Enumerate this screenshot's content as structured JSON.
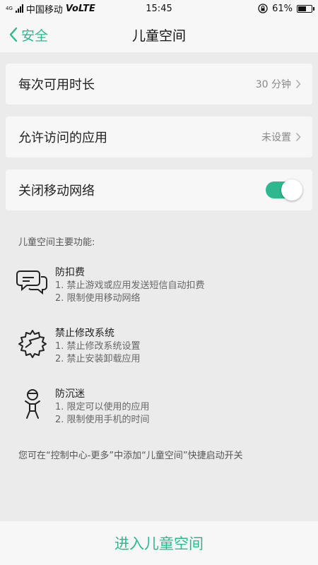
{
  "status_bar": {
    "network_type": "4G",
    "carrier": "中国移动",
    "volte": "VoLTE",
    "time": "15:45",
    "battery_percent": "61%",
    "battery_level": 0.61
  },
  "nav": {
    "back_label": "安全",
    "title": "儿童空间"
  },
  "settings": [
    {
      "label": "每次可用时长",
      "value": "30 分钟"
    },
    {
      "label": "允许访问的应用",
      "value": "未设置"
    },
    {
      "label": "关闭移动网络",
      "toggle_on": true
    }
  ],
  "features": {
    "heading": "儿童空间主要功能:",
    "items": [
      {
        "icon": "chat-bubbles-icon",
        "title": "防扣费",
        "lines": [
          "1. 禁止游戏或应用发送短信自动扣费",
          "2. 限制使用移动网络"
        ]
      },
      {
        "icon": "broken-gear-icon",
        "title": "禁止修改系统",
        "lines": [
          "1. 禁止修改系统设置",
          "2. 禁止安装卸载应用"
        ]
      },
      {
        "icon": "child-figure-icon",
        "title": "防沉迷",
        "lines": [
          "1. 限定可以使用的应用",
          "2. 限制使用手机的时间"
        ]
      }
    ]
  },
  "footnote": "您可在“控制中心-更多”中添加“儿童空间”快捷启动开关",
  "bottom_button": "进入儿童空间",
  "colors": {
    "accent": "#2fb890",
    "background": "#ebebeb",
    "card": "#f7f7f7"
  }
}
